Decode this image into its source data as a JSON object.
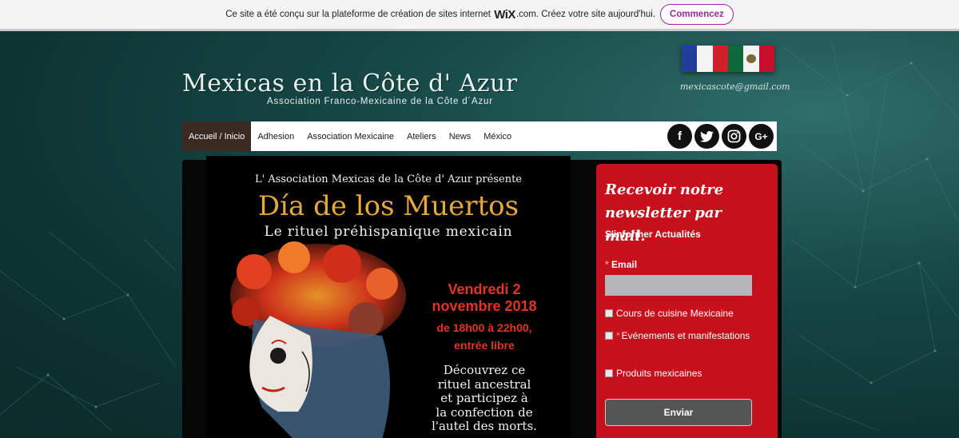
{
  "wix_banner": {
    "text_before": "Ce site a été conçu sur la plateforme de création de sites internet",
    "logo": "WiX",
    "text_after": ".com. Créez votre site aujourd'hui.",
    "button": "Commencez"
  },
  "header": {
    "title": "Mexicas en la Côte d' Azur",
    "subtitle": "Association Franco-Mexicaine de la Côte d´Azur",
    "email": "mexicascote@gmail.com"
  },
  "flags": {
    "france": [
      "#1f3f9a",
      "#f4f4f4",
      "#d11f2c"
    ],
    "mexico": [
      "#0b6a3a",
      "#f4f4f4",
      "#c8102e"
    ]
  },
  "nav": {
    "items": [
      "Accueil / Inicio",
      "Adhesion",
      "Association Mexicaine",
      "Ateliers",
      "News",
      "México"
    ],
    "active_index": 0,
    "social": [
      {
        "icon": "facebook-icon",
        "glyph": "f"
      },
      {
        "icon": "twitter-icon",
        "glyph": "🐦"
      },
      {
        "icon": "instagram-icon",
        "glyph": "◎"
      },
      {
        "icon": "google-plus-icon",
        "glyph": "G+"
      }
    ]
  },
  "poster": {
    "presente": "L' Association Mexicas de la Côte d' Azur présente",
    "title": "Día de los Muertos",
    "subtitle": "Le rituel préhispanique mexicain",
    "date_line1": "Vendredi 2",
    "date_line2": "novembre 2018",
    "time_line1": "de 18h00 à 22h00,",
    "time_line2": "entrée libre",
    "desc_lines": [
      "Découvrez ce",
      "rituel ancestral",
      "et participez à",
      "la confection de",
      "l'autel des morts."
    ]
  },
  "newsletter": {
    "title_line1": "Recevoir notre",
    "title_line2": "newsletter par mail.",
    "subtitle": "S'informer Actualités",
    "required_mark": "*",
    "email_label": "Email",
    "options": [
      "Cours de cuisine Mexicaine",
      "Evénements et manifestations",
      "Produits mexicaines"
    ],
    "submit": "Enviar"
  },
  "colors": {
    "accent_red": "#c6101b",
    "nav_active": "#3a2a21",
    "wix_purple": "#9b2a98",
    "background": "#0f3b3a"
  }
}
